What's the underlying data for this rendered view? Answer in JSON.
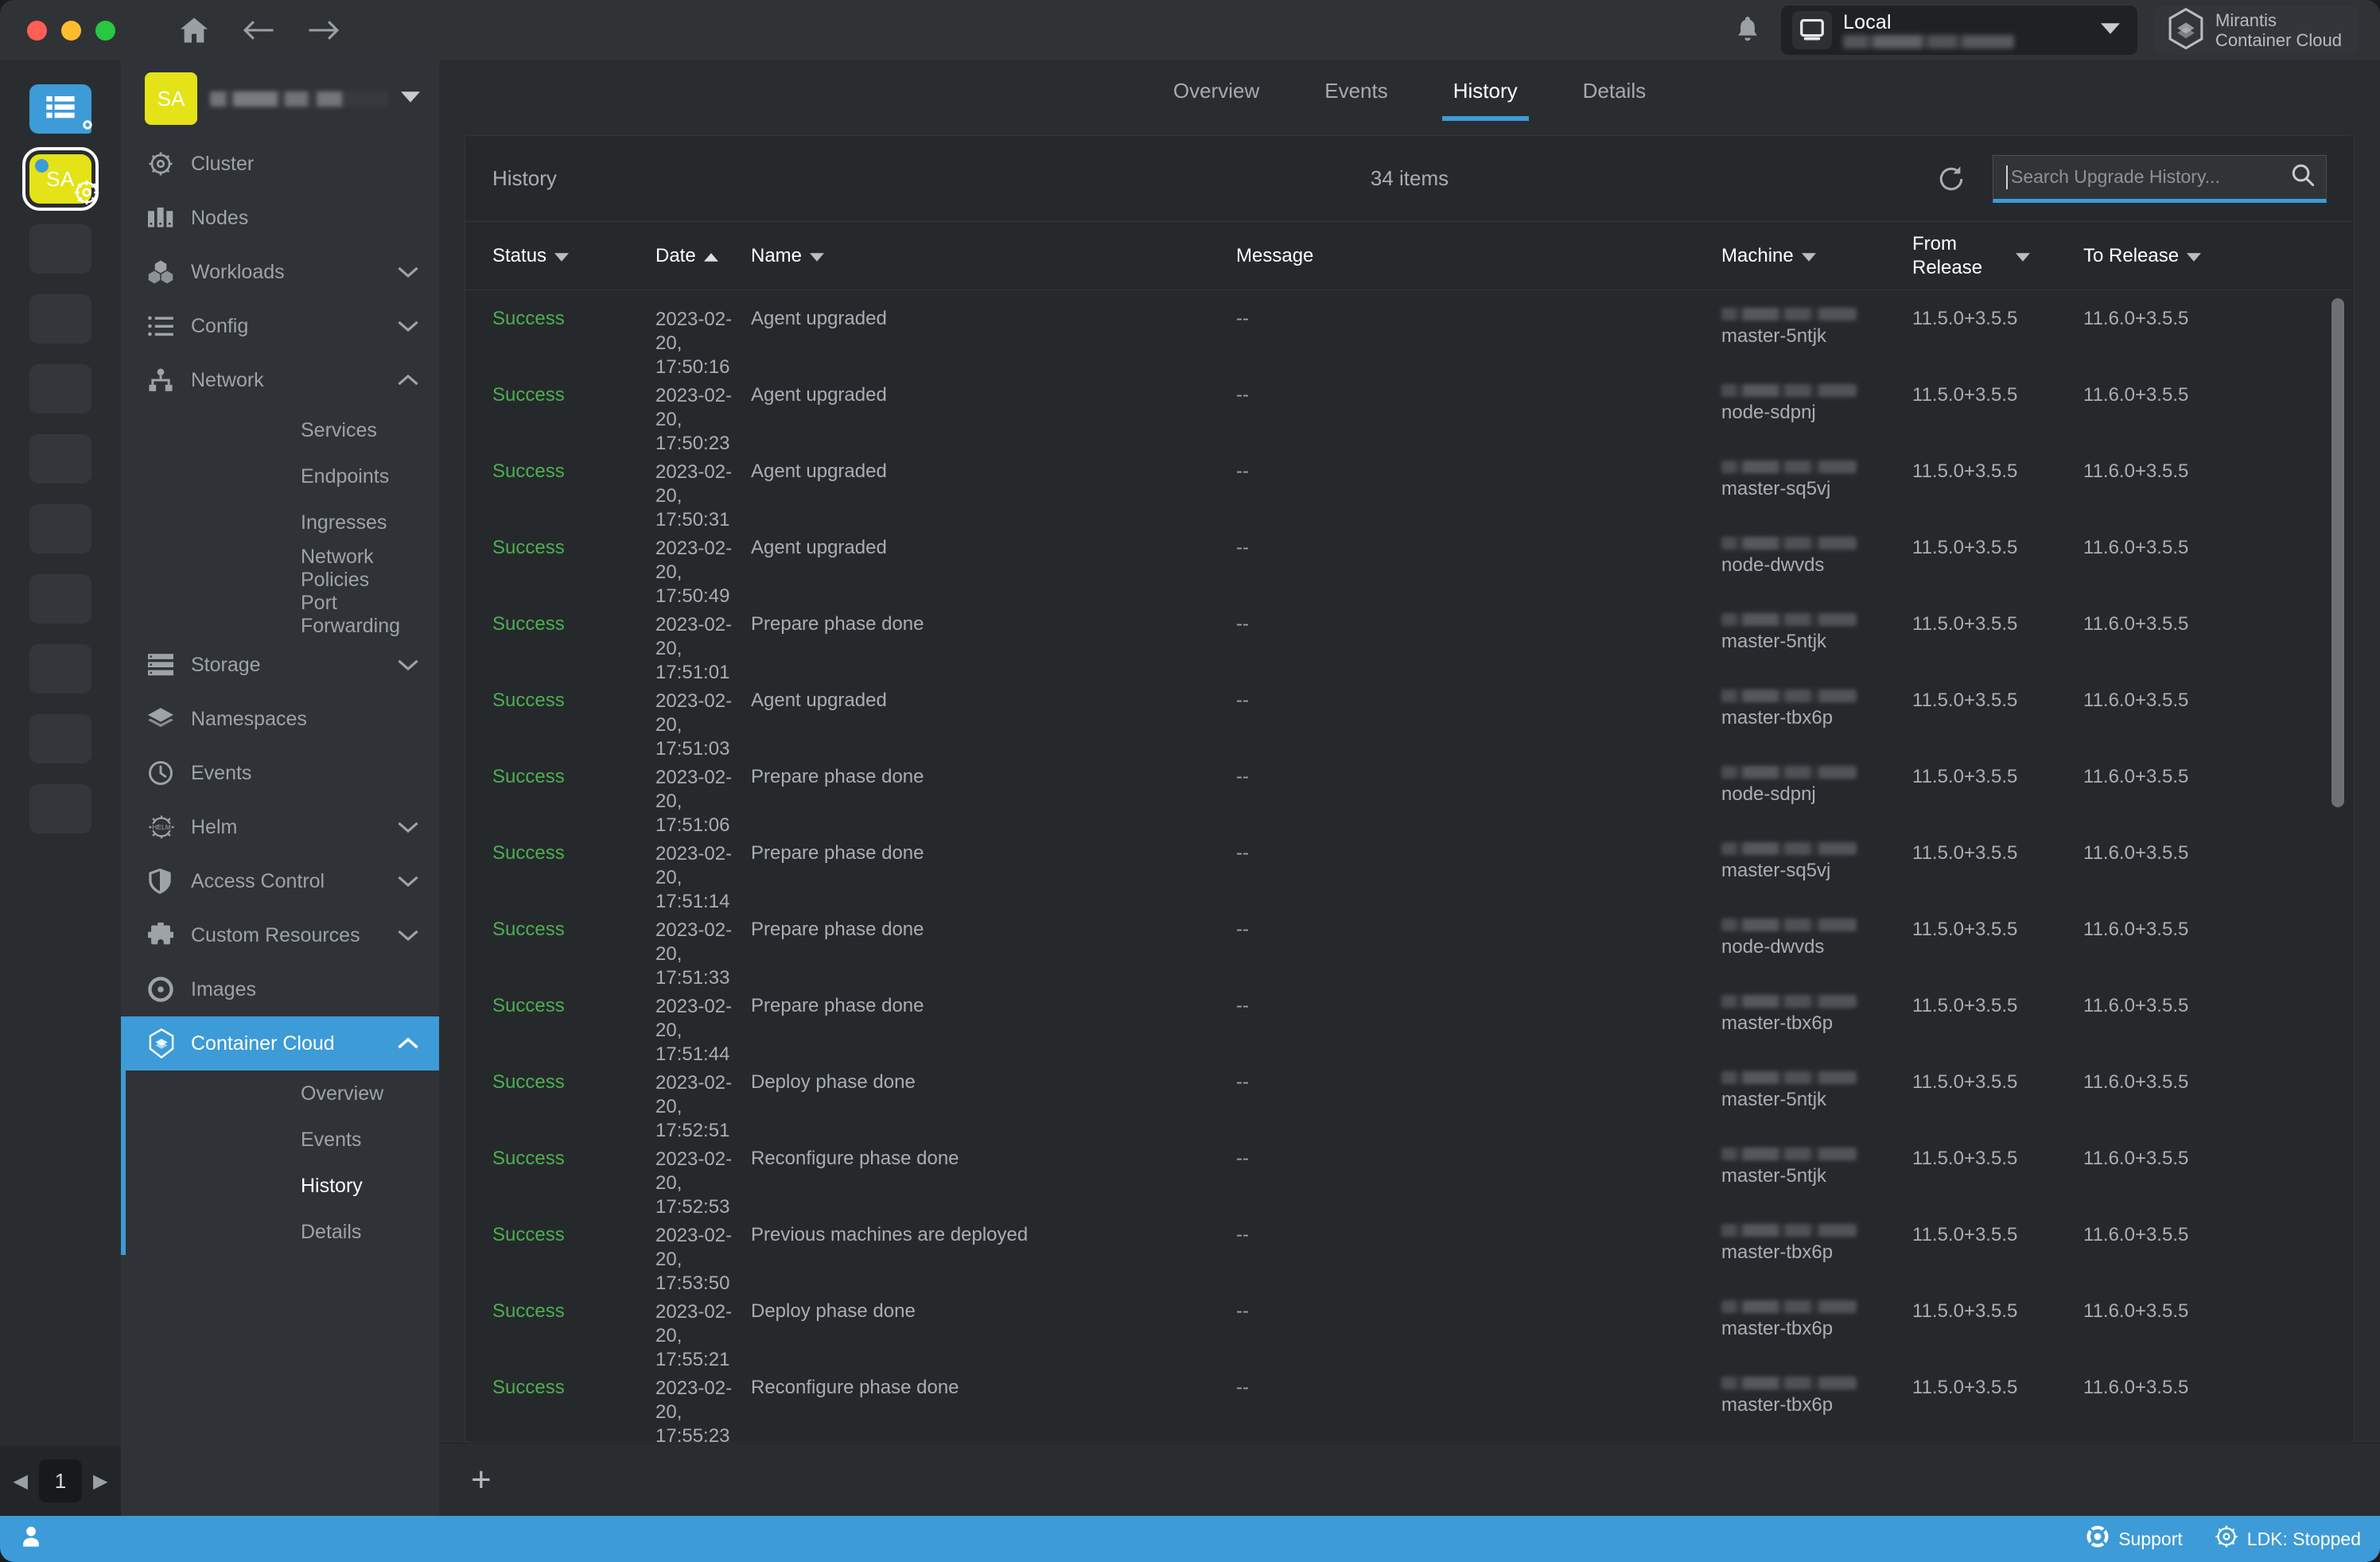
{
  "titlebar": {
    "home_icon": "home-icon",
    "back_icon": "arrow-left-icon",
    "forward_icon": "arrow-right-icon",
    "bell_icon": "bell-icon",
    "cluster": {
      "name": "Local",
      "subtitle_redacted": ""
    },
    "brand": {
      "line1": "Mirantis",
      "line2": "Container Cloud"
    }
  },
  "rail": {
    "tiles": [
      {
        "label": "",
        "kind": "blue",
        "icon": "list-icon",
        "badge": "gear-icon"
      },
      {
        "label": "SA",
        "kind": "yellow",
        "icon": "",
        "badge": "helm-wheel-icon"
      }
    ],
    "pagination": {
      "prev": "◀",
      "page": "1",
      "next": "▶"
    }
  },
  "sidebar": {
    "avatar_initials": "SA",
    "items": [
      {
        "label": "Cluster",
        "icon": "helm-wheel-icon",
        "expandable": false
      },
      {
        "label": "Nodes",
        "icon": "nodes-icon",
        "expandable": false
      },
      {
        "label": "Workloads",
        "icon": "workloads-icon",
        "expandable": true,
        "expanded": false
      },
      {
        "label": "Config",
        "icon": "config-icon",
        "expandable": true,
        "expanded": false
      },
      {
        "label": "Network",
        "icon": "network-icon",
        "expandable": true,
        "expanded": true
      },
      {
        "label": "Storage",
        "icon": "storage-icon",
        "expandable": true,
        "expanded": false
      },
      {
        "label": "Namespaces",
        "icon": "layers-icon",
        "expandable": false
      },
      {
        "label": "Events",
        "icon": "clock-icon",
        "expandable": false
      },
      {
        "label": "Helm",
        "icon": "helm-text-icon",
        "expandable": true,
        "expanded": false
      },
      {
        "label": "Access Control",
        "icon": "shield-icon",
        "expandable": true,
        "expanded": false
      },
      {
        "label": "Custom Resources",
        "icon": "puzzle-icon",
        "expandable": true,
        "expanded": false
      },
      {
        "label": "Images",
        "icon": "disc-icon",
        "expandable": false
      },
      {
        "label": "Container Cloud",
        "icon": "container-cloud-icon",
        "expandable": true,
        "expanded": true,
        "active": true
      }
    ],
    "network_children": [
      "Services",
      "Endpoints",
      "Ingresses",
      "Network Policies",
      "Port Forwarding"
    ],
    "container_cloud_children": [
      "Overview",
      "Events",
      "History",
      "Details"
    ],
    "container_cloud_current": "History"
  },
  "main": {
    "tabs": [
      {
        "label": "Overview",
        "active": false
      },
      {
        "label": "Events",
        "active": false
      },
      {
        "label": "History",
        "active": true
      },
      {
        "label": "Details",
        "active": false
      }
    ],
    "panel": {
      "title": "History",
      "count": "34 items",
      "refresh_icon": "refresh-icon",
      "search": {
        "value": "",
        "placeholder": "Search Upgrade History...",
        "icon": "search-icon"
      }
    },
    "table": {
      "columns": [
        {
          "key": "status",
          "label": "Status",
          "sort": "desc-caret"
        },
        {
          "key": "date",
          "label": "Date",
          "sort": "asc"
        },
        {
          "key": "name",
          "label": "Name",
          "sort": "desc-caret"
        },
        {
          "key": "message",
          "label": "Message",
          "sort": ""
        },
        {
          "key": "machine",
          "label": "Machine",
          "sort": "desc-caret"
        },
        {
          "key": "from",
          "label": "From Release",
          "sort": "desc-caret"
        },
        {
          "key": "to",
          "label": "To Release",
          "sort": "desc-caret"
        }
      ],
      "rows": [
        {
          "status": "Success",
          "date": "2023-02-20,",
          "time": "17:50:16",
          "name": "Agent upgraded",
          "message": "--",
          "machine": "master-5ntjk",
          "from": "11.5.0+3.5.5",
          "to": "11.6.0+3.5.5"
        },
        {
          "status": "Success",
          "date": "2023-02-20,",
          "time": "17:50:23",
          "name": "Agent upgraded",
          "message": "--",
          "machine": "node-sdpnj",
          "from": "11.5.0+3.5.5",
          "to": "11.6.0+3.5.5"
        },
        {
          "status": "Success",
          "date": "2023-02-20,",
          "time": "17:50:31",
          "name": "Agent upgraded",
          "message": "--",
          "machine": "master-sq5vj",
          "from": "11.5.0+3.5.5",
          "to": "11.6.0+3.5.5"
        },
        {
          "status": "Success",
          "date": "2023-02-20,",
          "time": "17:50:49",
          "name": "Agent upgraded",
          "message": "--",
          "machine": "node-dwvds",
          "from": "11.5.0+3.5.5",
          "to": "11.6.0+3.5.5"
        },
        {
          "status": "Success",
          "date": "2023-02-20,",
          "time": "17:51:01",
          "name": "Prepare phase done",
          "message": "--",
          "machine": "master-5ntjk",
          "from": "11.5.0+3.5.5",
          "to": "11.6.0+3.5.5"
        },
        {
          "status": "Success",
          "date": "2023-02-20,",
          "time": "17:51:03",
          "name": "Agent upgraded",
          "message": "--",
          "machine": "master-tbx6p",
          "from": "11.5.0+3.5.5",
          "to": "11.6.0+3.5.5"
        },
        {
          "status": "Success",
          "date": "2023-02-20,",
          "time": "17:51:06",
          "name": "Prepare phase done",
          "message": "--",
          "machine": "node-sdpnj",
          "from": "11.5.0+3.5.5",
          "to": "11.6.0+3.5.5"
        },
        {
          "status": "Success",
          "date": "2023-02-20,",
          "time": "17:51:14",
          "name": "Prepare phase done",
          "message": "--",
          "machine": "master-sq5vj",
          "from": "11.5.0+3.5.5",
          "to": "11.6.0+3.5.5"
        },
        {
          "status": "Success",
          "date": "2023-02-20,",
          "time": "17:51:33",
          "name": "Prepare phase done",
          "message": "--",
          "machine": "node-dwvds",
          "from": "11.5.0+3.5.5",
          "to": "11.6.0+3.5.5"
        },
        {
          "status": "Success",
          "date": "2023-02-20,",
          "time": "17:51:44",
          "name": "Prepare phase done",
          "message": "--",
          "machine": "master-tbx6p",
          "from": "11.5.0+3.5.5",
          "to": "11.6.0+3.5.5"
        },
        {
          "status": "Success",
          "date": "2023-02-20,",
          "time": "17:52:51",
          "name": "Deploy phase done",
          "message": "--",
          "machine": "master-5ntjk",
          "from": "11.5.0+3.5.5",
          "to": "11.6.0+3.5.5"
        },
        {
          "status": "Success",
          "date": "2023-02-20,",
          "time": "17:52:53",
          "name": "Reconfigure phase done",
          "message": "--",
          "machine": "master-5ntjk",
          "from": "11.5.0+3.5.5",
          "to": "11.6.0+3.5.5"
        },
        {
          "status": "Success",
          "date": "2023-02-20,",
          "time": "17:53:50",
          "name": "Previous machines are deployed",
          "message": "--",
          "machine": "master-tbx6p",
          "from": "11.5.0+3.5.5",
          "to": "11.6.0+3.5.5"
        },
        {
          "status": "Success",
          "date": "2023-02-20,",
          "time": "17:55:21",
          "name": "Deploy phase done",
          "message": "--",
          "machine": "master-tbx6p",
          "from": "11.5.0+3.5.5",
          "to": "11.6.0+3.5.5"
        },
        {
          "status": "Success",
          "date": "2023-02-20,",
          "time": "17:55:23",
          "name": "Reconfigure phase done",
          "message": "--",
          "machine": "master-tbx6p",
          "from": "11.5.0+3.5.5",
          "to": "11.6.0+3.5.5"
        }
      ]
    },
    "add_button": "+"
  },
  "statusbar": {
    "user_icon": "user-icon",
    "support": {
      "label": "Support",
      "icon": "lifebuoy-icon"
    },
    "ldk": {
      "label": "LDK: Stopped",
      "icon": "helm-wheel-icon"
    }
  },
  "colors": {
    "accent": "#3d9bd8",
    "success": "#4caf50",
    "avatar": "#e3e317",
    "panel_bg": "#26292c",
    "sidebar_bg": "#2f3337"
  }
}
